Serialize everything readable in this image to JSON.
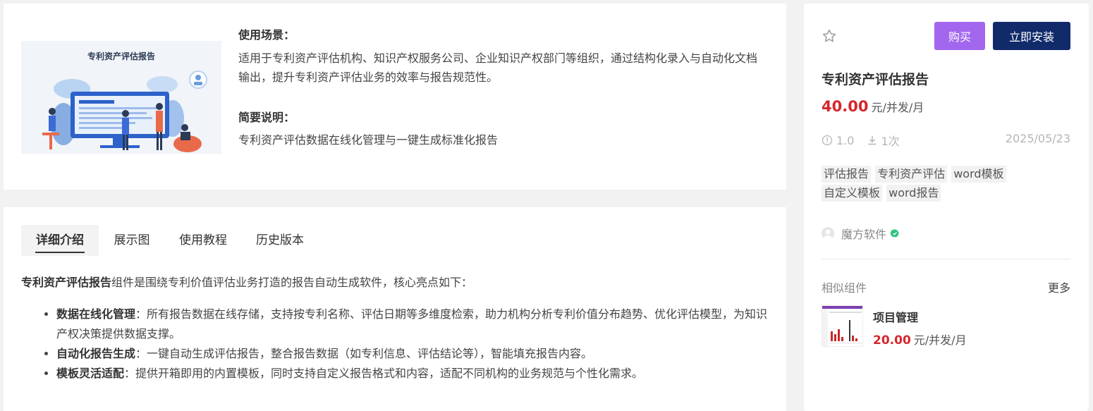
{
  "product_image": {
    "title": "专利资产评估报告"
  },
  "usage": {
    "heading": "使用场景：",
    "text": "适用于专利资产评估机构、知识产权服务公司、企业知识产权部门等组织，通过结构化录入与自动化文档输出，提升专利资产评估业务的效率与报告规范性。"
  },
  "summary": {
    "heading": "简要说明：",
    "text": "专利资产评估数据在线化管理与一键生成标准化报告"
  },
  "tabs": [
    {
      "label": "详细介绍",
      "active": true
    },
    {
      "label": "展示图",
      "active": false
    },
    {
      "label": "使用教程",
      "active": false
    },
    {
      "label": "历史版本",
      "active": false
    }
  ],
  "detail": {
    "intro_bold": "专利资产评估报告",
    "intro_rest": "组件是围绕专利价值评估业务打造的报告自动生成软件，核心亮点如下：",
    "features": [
      {
        "title": "数据在线化管理",
        "text": "：所有报告数据在线存储，支持按专利名称、评估日期等多维度检索，助力机构分析专利价值分布趋势、优化评估模型，为知识产权决策提供数据支撑。"
      },
      {
        "title": "自动化报告生成",
        "text": "：一键自动生成评估报告，整合报告数据（如专利信息、评估结论等），智能填充报告内容。"
      },
      {
        "title": "模板灵活适配",
        "text": "：提供开箱即用的内置模板，同时支持自定义报告格式和内容，适配不同机构的业务规范与个性化需求。"
      }
    ]
  },
  "side": {
    "star_icon": "star-outline-icon",
    "buy_label": "购买",
    "install_label": "立即安装",
    "name": "专利资产评估报告",
    "price": "40.00",
    "price_unit": "元/并发/月",
    "version": "1.0",
    "downloads": "1次",
    "date": "2025/05/23",
    "tags": [
      "评估报告",
      "专利资产评估",
      "word模板",
      "自定义模板",
      "word报告"
    ],
    "vendor": "魔方软件",
    "similar_label": "相似组件",
    "more_label": "更多",
    "similar": [
      {
        "name": "项目管理",
        "price": "20.00",
        "price_unit": "元/并发/月"
      }
    ]
  },
  "colors": {
    "buy_button": "#a267ee",
    "install_button": "#102a6a",
    "price": "#d4262c",
    "verified": "#2ec27e"
  }
}
